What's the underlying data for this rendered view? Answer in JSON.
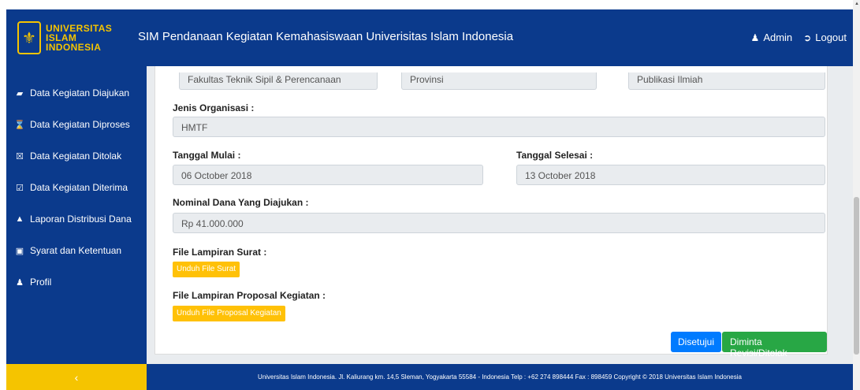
{
  "header": {
    "logo_lines": [
      "UNIVERSITAS",
      "ISLAM",
      "INDONESIA"
    ],
    "title": "SIM Pendanaan Kegiatan Kemahasiswaan Univerisitas Islam Indonesia",
    "admin_label": "Admin",
    "logout_label": "Logout"
  },
  "sidebar": {
    "items": [
      {
        "label": "Data Kegiatan Diajukan",
        "icon": "inbox-icon"
      },
      {
        "label": "Data Kegiatan Diproses",
        "icon": "hourglass-icon"
      },
      {
        "label": "Data Kegiatan Ditolak",
        "icon": "x-square-icon"
      },
      {
        "label": "Data Kegiatan Diterima",
        "icon": "check-square-icon"
      },
      {
        "label": "Laporan Distribusi Dana",
        "icon": "chart-icon"
      },
      {
        "label": "Syarat dan Ketentuan",
        "icon": "book-icon"
      },
      {
        "label": "Profil",
        "icon": "user-icon"
      }
    ],
    "collapse_label": "‹"
  },
  "form": {
    "top_fields": [
      "Fakultas Teknik Sipil & Perencanaan",
      "Provinsi",
      "Publikasi Ilmiah"
    ],
    "jenis_organisasi_label": "Jenis Organisasi :",
    "jenis_organisasi_value": "HMTF",
    "tanggal_mulai_label": "Tanggal Mulai :",
    "tanggal_mulai_value": "06 October 2018",
    "tanggal_selesai_label": "Tanggal Selesai :",
    "tanggal_selesai_value": "13 October 2018",
    "nominal_label": "Nominal Dana Yang Diajukan :",
    "nominal_value": "Rp 41.000.000",
    "file_surat_label": "File Lampiran Surat :",
    "file_surat_button": "Unduh File Surat",
    "file_proposal_label": "File Lampiran Proposal Kegiatan :",
    "file_proposal_button": "Unduh File Proposal Kegiatan",
    "approve_button": "Disetujui",
    "reject_button": "Diminta Revisi/Ditolak"
  },
  "footer": {
    "text": "Universitas Islam Indonesia. Jl. Kaliurang km. 14,5 Sleman, Yogyakarta 55584 - Indonesia Telp : +62 274 898444 Fax : 898459 Copyright © 2018 Universitas Islam Indonesia"
  },
  "colors": {
    "brand_blue": "#0b3a8c",
    "brand_yellow": "#f5c400",
    "primary": "#007bff",
    "success": "#28a745",
    "warning": "#ffc107"
  }
}
